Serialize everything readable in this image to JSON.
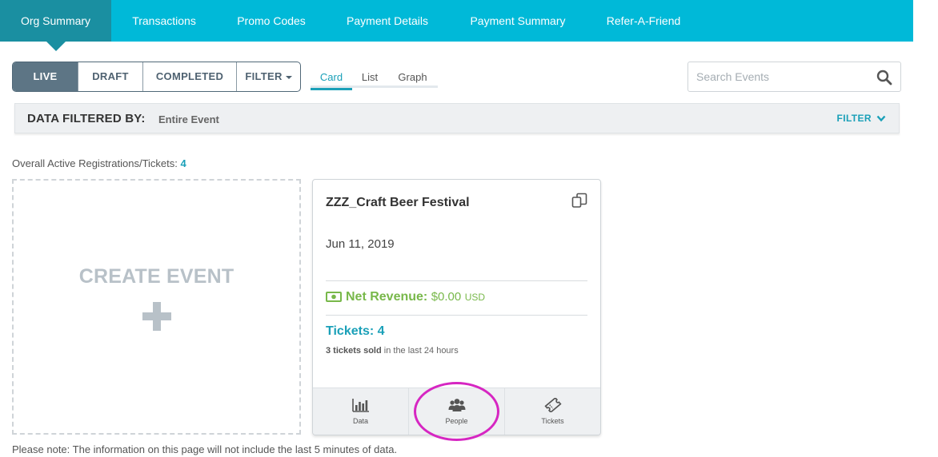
{
  "nav": {
    "tabs": [
      {
        "label": "Org Summary",
        "active": true
      },
      {
        "label": "Transactions"
      },
      {
        "label": "Promo Codes"
      },
      {
        "label": "Payment Details"
      },
      {
        "label": "Payment Summary"
      },
      {
        "label": "Refer-A-Friend"
      }
    ]
  },
  "status_filter": {
    "buttons": [
      {
        "label": "LIVE",
        "active": true
      },
      {
        "label": "DRAFT"
      },
      {
        "label": "COMPLETED"
      },
      {
        "label": "FILTER"
      }
    ]
  },
  "view_toggle": {
    "options": [
      {
        "label": "Card",
        "active": true
      },
      {
        "label": "List"
      },
      {
        "label": "Graph"
      }
    ]
  },
  "search": {
    "placeholder": "Search Events",
    "value": "",
    "icon": "search-icon"
  },
  "filter_bar": {
    "label": "DATA FILTERED BY:",
    "value": "Entire Event",
    "toggle_label": "FILTER",
    "toggle_icon": "chevron-down-icon"
  },
  "overall": {
    "label": "Overall Active Registrations/Tickets:",
    "count": "4"
  },
  "create_event": {
    "label": "CREATE EVENT",
    "icon": "plus-icon"
  },
  "event_card": {
    "title": "ZZZ_Craft Beer Festival",
    "date": "Jun 11, 2019",
    "net_revenue_label": "Net Revenue:",
    "net_revenue_amount": "$0.00",
    "net_revenue_currency": "USD",
    "tickets_label": "Tickets: 4",
    "sold_count": "3 tickets sold",
    "sold_suffix": "in the last 24 hours",
    "actions": [
      {
        "label": "Data",
        "icon": "bar-chart-icon"
      },
      {
        "label": "People",
        "icon": "people-icon"
      },
      {
        "label": "Tickets",
        "icon": "ticket-icon"
      }
    ]
  },
  "note": "Please note: The information on this page will not include the last 5 minutes of data.",
  "colors": {
    "nav_bg": "#00b9d8",
    "nav_active": "#1a8fa1",
    "accent": "#1aa0b8",
    "revenue_green": "#78b84a",
    "highlight": "#d626c2"
  }
}
